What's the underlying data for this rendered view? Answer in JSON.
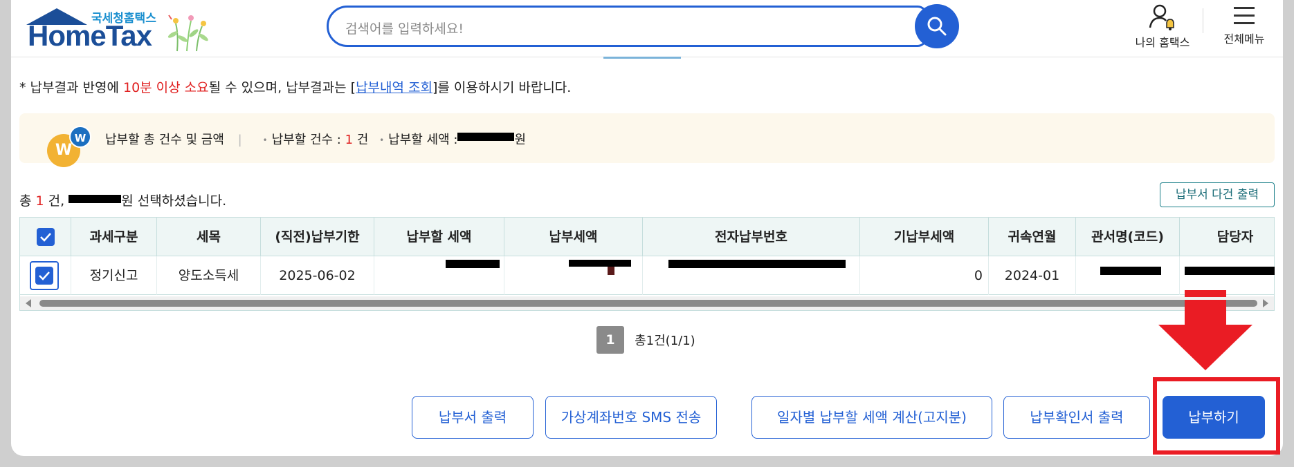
{
  "header": {
    "logo_sub": "국세청홈택스",
    "logo_word": "HomeTax",
    "search_placeholder": "검색어를 입력하세요!",
    "my_hometax": "나의 홈택스",
    "all_menu": "전체메뉴"
  },
  "notice": {
    "prefix": "* 납부결과 반영에 ",
    "red": "10분 이상 소요",
    "middle": "될 수 있으며, 납부결과는 [",
    "link": "납부내역 조회",
    "suffix": "]를 이용하시기 바랍니다."
  },
  "summary": {
    "coin_main": "W",
    "coin_small": "W",
    "title": "납부할 총 건수 및 금액",
    "divider": "|",
    "count_label": "납부할 건수 : ",
    "count_value": "1",
    "count_unit": " 건",
    "amount_label": "납부할 세액 :",
    "amount_unit": "원"
  },
  "selection": {
    "prefix": "총 ",
    "count": "1",
    "middle": " 건, ",
    "suffix": "원 선택하셨습니다."
  },
  "multi_print_label": "납부서 다건 출력",
  "table": {
    "headers": [
      "과세구분",
      "세목",
      "(직전)납부기한",
      "납부할 세액",
      "납부세액",
      "전자납부번호",
      "기납부세액",
      "귀속연월",
      "관서명(코드)",
      "담당자"
    ],
    "row": {
      "tax_type": "정기신고",
      "tax_item": "양도소득세",
      "due_date": "2025-06-02",
      "prepaid": "0",
      "period": "2024-01"
    }
  },
  "pager": {
    "current": "1",
    "total": "총1건(1/1)"
  },
  "buttons": {
    "print_bill": "납부서 출력",
    "sms": "가상계좌번호 SMS 전송",
    "daily_calc": "일자별 납부할 세액 계산(고지분)",
    "confirm_print": "납부확인서 출력",
    "pay": "납부하기"
  },
  "colors": {
    "brand_blue": "#2360d4",
    "logo_blue": "#1b4e98",
    "highlight_red": "#ea1c24",
    "notice_red": "#e02020"
  },
  "icons": {
    "search": "search-icon",
    "my_hometax": "user-bell-icon",
    "menu": "hamburger-icon",
    "check": "check-icon",
    "arrow": "arrow-down-icon"
  }
}
